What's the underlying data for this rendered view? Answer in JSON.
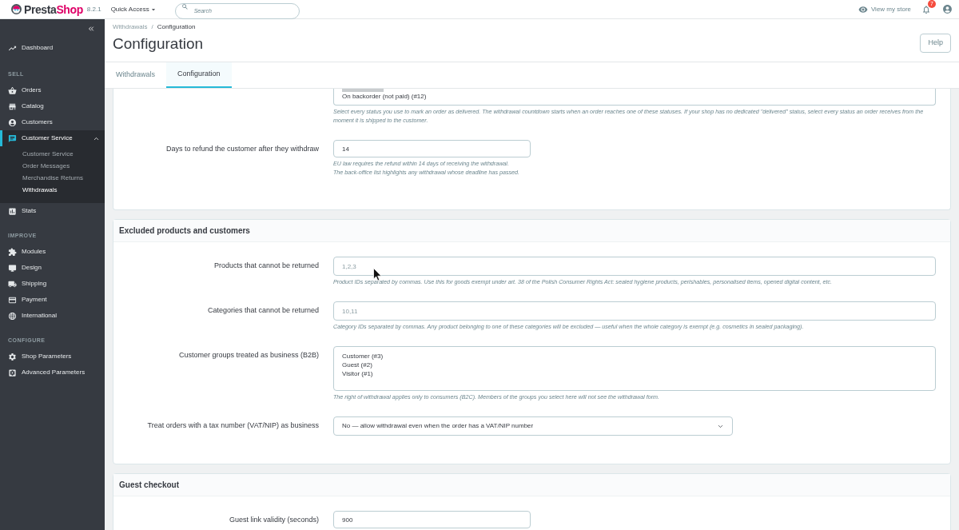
{
  "header": {
    "logo": {
      "parts": [
        "Presta",
        "Shop"
      ]
    },
    "version": "8.2.1",
    "quick_access": "Quick Access",
    "search": {
      "placeholder": "Search"
    },
    "view_store": "View my store",
    "notifications": {
      "count": "7"
    }
  },
  "sidebar": {
    "groups": [
      {
        "items": [
          {
            "label": "Dashboard",
            "selected": false
          }
        ]
      },
      {
        "heading": "SELL",
        "items": [
          {
            "label": "Orders",
            "selected": false
          },
          {
            "label": "Catalog",
            "selected": false
          },
          {
            "label": "Customers",
            "selected": false
          },
          {
            "label": "Customer Service",
            "selected": true,
            "expanded": true,
            "children": [
              {
                "label": "Customer Service",
                "selected": false
              },
              {
                "label": "Order Messages",
                "selected": false
              },
              {
                "label": "Merchandise Returns",
                "selected": false
              },
              {
                "label": "Withdrawals",
                "selected": true
              }
            ]
          },
          {
            "label": "Stats",
            "selected": false
          }
        ]
      },
      {
        "heading": "IMPROVE",
        "items": [
          {
            "label": "Modules",
            "selected": false
          },
          {
            "label": "Design",
            "selected": false
          },
          {
            "label": "Shipping",
            "selected": false
          },
          {
            "label": "Payment",
            "selected": false
          },
          {
            "label": "International",
            "selected": false
          }
        ]
      },
      {
        "heading": "CONFIGURE",
        "items": [
          {
            "label": "Shop Parameters",
            "selected": false
          },
          {
            "label": "Advanced Parameters",
            "selected": false
          }
        ]
      }
    ]
  },
  "breadcrumb": {
    "items": [
      "Withdrawals",
      "Configuration"
    ],
    "separator": "/"
  },
  "page_title": "Configuration",
  "help_button": "Help",
  "tabs": [
    {
      "label": "Withdrawals",
      "selected": false
    },
    {
      "label": "Configuration",
      "selected": true
    }
  ],
  "panels": [
    {
      "fields": [
        {
          "kind": "listbox",
          "options": [
            {
              "cut": true,
              "selected": true
            },
            {
              "cut": false,
              "label": "On backorder (not paid) (#12)",
              "selected": false
            }
          ],
          "help": [
            "Select every status you use to mark an order as delivered. The withdrawal countdown starts when an order reaches one of these statuses. If your shop has no dedicated \"delivered\" status, select every status an order receives from the moment it is shipped to the customer."
          ]
        },
        {
          "kind": "number",
          "label": "Days to refund the customer after they withdraw",
          "value": "14",
          "help": [
            "EU law requires the refund within 14 days of receiving the withdrawal.",
            "The back-office list highlights any withdrawal whose deadline has passed."
          ]
        }
      ]
    },
    {
      "title": "Excluded products and customers",
      "fields": [
        {
          "kind": "text",
          "label": "Products that cannot be returned",
          "placeholder": "1,2,3",
          "help": [
            "Product IDs separated by commas. Use this for goods exempt under art. 38 of the Polish Consumer Rights Act: sealed hygiene products, perishables, personalised items, opened digital content, etc."
          ]
        },
        {
          "kind": "text",
          "label": "Categories that cannot be returned",
          "placeholder": "10,11",
          "help": [
            "Category IDs separated by commas. Any product belonging to one of these categories will be excluded — useful when the whole category is exempt (e.g. cosmetics in sealed packaging)."
          ]
        },
        {
          "kind": "listbox",
          "label": "Customer groups treated as business (B2B)",
          "options": [
            {
              "cut": false,
              "label": "Customer (#3)",
              "selected": false
            },
            {
              "cut": false,
              "label": "Guest (#2)",
              "selected": false
            },
            {
              "cut": false,
              "label": "Visitor (#1)",
              "selected": false
            }
          ],
          "help": [
            "The right of withdrawal applies only to consumers (B2C). Members of the groups you select here will not see the withdrawal form."
          ]
        },
        {
          "kind": "select",
          "label": "Treat orders with a tax number (VAT/NIP) as business",
          "value": "No — allow withdrawal even when the order has a VAT/NIP number"
        }
      ]
    },
    {
      "title": "Guest checkout",
      "fields": [
        {
          "kind": "number",
          "label": "Guest link validity (seconds)",
          "value": "900"
        }
      ]
    }
  ]
}
